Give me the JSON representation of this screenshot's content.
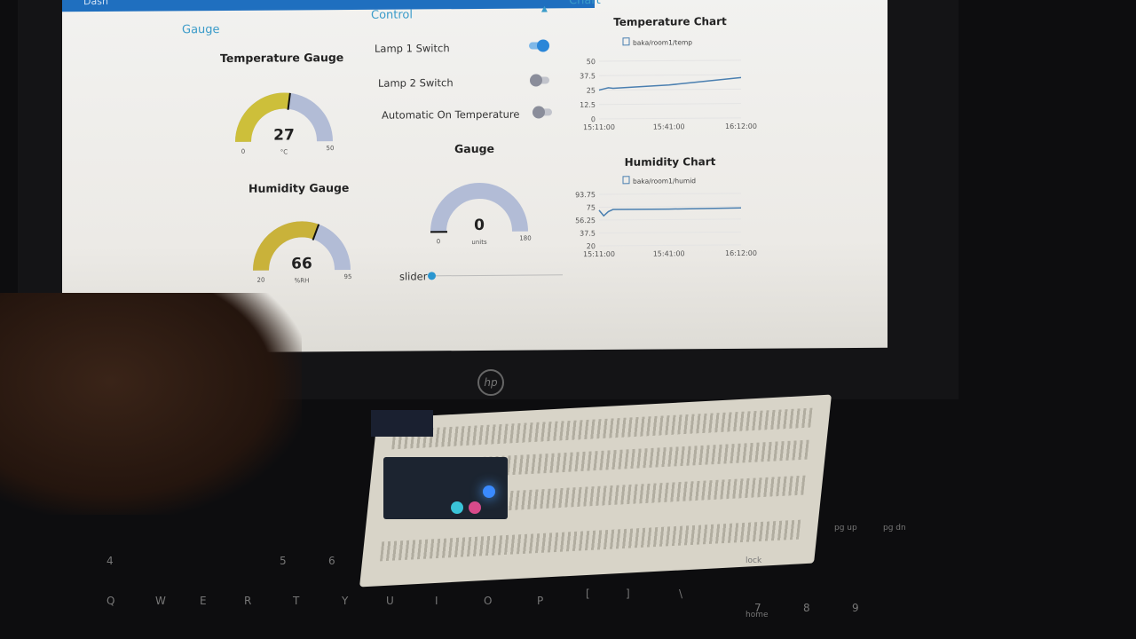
{
  "dashboard": {
    "header_title": "Dash",
    "gauge_group": {
      "label": "Gauge",
      "temperature_gauge": {
        "title": "Temperature Gauge",
        "value": 27,
        "min": 0,
        "max": 50,
        "unit": "°C",
        "color": "#cdbf3a"
      },
      "humidity_gauge": {
        "title": "Humidity Gauge",
        "value": 66,
        "min": 20,
        "max": 95,
        "unit": "%RH",
        "color": "#c9b23a"
      }
    },
    "control_group": {
      "label": "Control",
      "switches": [
        {
          "label": "Lamp 1 Switch",
          "on": true
        },
        {
          "label": "Lamp 2 Switch",
          "on": false
        },
        {
          "label": "Automatic On Temperature",
          "on": false
        }
      ],
      "gauge": {
        "title": "Gauge",
        "value": 0,
        "min": 0,
        "max": 180,
        "unit": "units"
      },
      "slider": {
        "label": "slider",
        "value": 0
      }
    },
    "chart_group": {
      "label": "Chart"
    }
  },
  "chart_data": [
    {
      "type": "line",
      "title": "Temperature Chart",
      "series": [
        {
          "name": "baka/room1/temp",
          "x": [
            "15:11:00",
            "15:13:00",
            "15:15:00",
            "15:17:00",
            "15:41:00",
            "16:12:00"
          ],
          "y": [
            25,
            26,
            27,
            26.5,
            29,
            35
          ]
        }
      ],
      "yticks": [
        "50",
        "37.5",
        "25",
        "12.5",
        "0"
      ],
      "xticks": [
        "15:11:00",
        "15:41:00",
        "16:12:00"
      ],
      "ylim": [
        0,
        50
      ],
      "grid": true,
      "legend": "top"
    },
    {
      "type": "line",
      "title": "Humidity Chart",
      "series": [
        {
          "name": "baka/room1/humid",
          "x": [
            "15:11:00",
            "15:13:00",
            "15:15:00",
            "15:17:00",
            "15:41:00",
            "16:12:00"
          ],
          "y": [
            71,
            63,
            69,
            72,
            72,
            73
          ]
        }
      ],
      "yticks": [
        "93.75",
        "75",
        "56.25",
        "37.5",
        "20"
      ],
      "xticks": [
        "15:11:00",
        "15:41:00",
        "16:12:00"
      ],
      "ylim": [
        20,
        93.75
      ],
      "grid": true,
      "legend": "top"
    }
  ],
  "laptop": {
    "brand": "hp"
  },
  "keyboard": {
    "keys": [
      "Q",
      "W",
      "E",
      "R",
      "T",
      "Y",
      "U",
      "I",
      "O",
      "P",
      "[",
      "]",
      "\\",
      "7",
      "8",
      "9",
      "4",
      "5",
      "6",
      "pg up",
      "pg dn",
      "lock",
      "home"
    ]
  },
  "colors": {
    "accent": "#3a9bc9",
    "switch_on": "#2a86d8",
    "gauge_empty": "#b2bcd6",
    "line": "#4a7fb0"
  }
}
